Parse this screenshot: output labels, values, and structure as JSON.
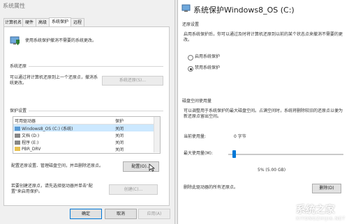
{
  "left_window": {
    "title": "系统属性",
    "tabs": [
      "计算机名",
      "硬件",
      "高级",
      "系统保护",
      "远程"
    ],
    "active_tab": "系统保护",
    "intro_text": "使用系统保护撤消不需要的系统更改。",
    "restore_section": {
      "title": "系统还原",
      "text": "可以通过将计算机还原到上一个还原点，撤消系统更改。",
      "button": "系统还原(S)..."
    },
    "protection_section": {
      "title": "保护设置",
      "columns": [
        "可用驱动器",
        "保护"
      ],
      "drives": [
        {
          "name": "Windows8_OS (C:) (系统)",
          "status": "关闭"
        },
        {
          "name": "文档 (D:)",
          "status": "关闭"
        },
        {
          "name": "程序 (E:)",
          "status": "关闭"
        },
        {
          "name": "PBR_DRV",
          "status": "关闭"
        }
      ],
      "configure_text": "配置还原设置、管理磁盘空间，并且删除还原点。",
      "configure_button": "配置(O)...",
      "create_text": "若要创建还原点，请先选择驱动器并单击\"配置\"来启用保护。",
      "create_button": "创建(C)..."
    },
    "footer": {
      "ok": "确定",
      "cancel": "取消",
      "apply": "应用(A)"
    }
  },
  "right_window": {
    "title": "系统保护Windows8_OS (C:)",
    "restore_settings": {
      "title": "还原设置",
      "text": "启用系统保护后，你可以通过及时将计算机还原到以前的某个状态点来撤消不需要的更改。",
      "options": [
        {
          "label": "启用系统保护",
          "selected": false
        },
        {
          "label": "禁用系统保护",
          "selected": true
        }
      ]
    },
    "disk_usage": {
      "title": "磁盘空间使用量",
      "text": "可以调整用于系统保护的最大磁盘空间。占满空间时，系统将删除较旧的还原点以便为新还原点留出空间。",
      "current_label": "当前使用量:",
      "current_value": "0 字节",
      "max_label": "最大使用量(M):",
      "slider_fraction": 0.05,
      "max_value_text": "5% (5.00 GB)",
      "delete_text": "删除此驱动器的所有还原点。",
      "delete_button": "删除(D)"
    }
  },
  "watermark": {
    "text": "系统之家",
    "sub": "XITONGZHIJIA.NET"
  }
}
